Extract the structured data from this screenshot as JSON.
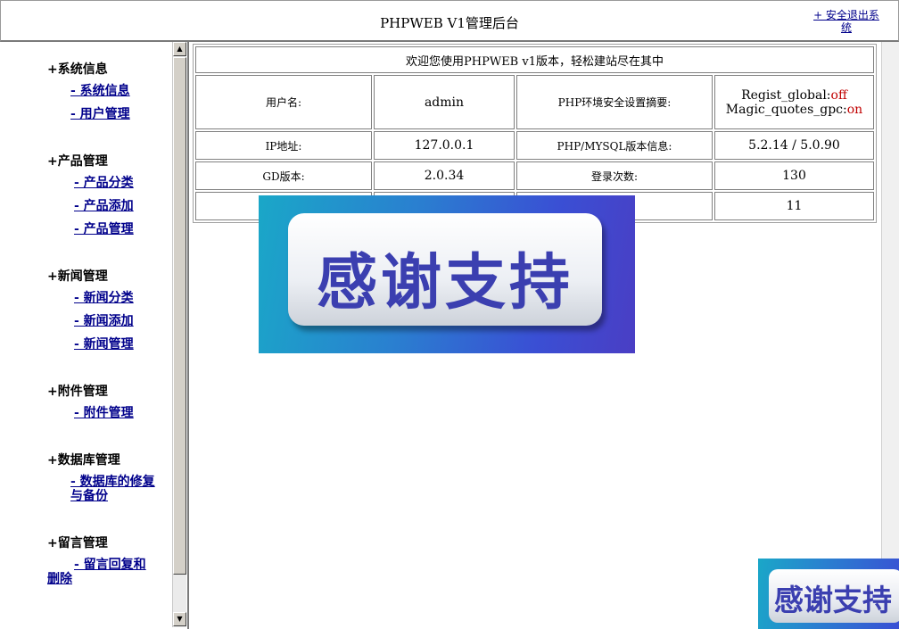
{
  "header": {
    "title": "PHPWEB V1管理后台",
    "logout": "+ 安全退出系统"
  },
  "sidebar": {
    "groups": [
      {
        "title": "+系统信息",
        "items": [
          "- 系统信息",
          "- 用户管理"
        ]
      },
      {
        "title": "+产品管理",
        "items": [
          "- 产品分类",
          "- 产品添加",
          "- 产品管理"
        ]
      },
      {
        "title": "+新闻管理",
        "items": [
          "- 新闻分类",
          "- 新闻添加",
          "- 新闻管理"
        ]
      },
      {
        "title": "+附件管理",
        "items": [
          "- 附件管理"
        ]
      },
      {
        "title": "+数据库管理",
        "items": [
          "- 数据库的修复与备份"
        ]
      },
      {
        "title": "+留言管理",
        "items": [
          "- 留言回复和删除"
        ]
      }
    ],
    "scroll_up": "▲",
    "scroll_down": "▼"
  },
  "main": {
    "welcome": "欢迎您使用PHPWEB v1版本，轻松建站尽在其中",
    "rows": [
      {
        "label1": "用户名:",
        "value1": "admin",
        "label2": "PHP环境安全设置摘要:",
        "value2_a_label": "Regist_global:",
        "value2_a_val": "off",
        "value2_b_label": "Magic_quotes_gpc:",
        "value2_b_val": "on"
      },
      {
        "label1": "IP地址:",
        "value1": "127.0.0.1",
        "label2": "PHP/MYSQL版本信息:",
        "value2": "5.2.14 / 5.0.90"
      },
      {
        "label1": "GD版本:",
        "value1": "2.0.34",
        "label2": "登录次数:",
        "value2": "130"
      },
      {
        "value2": "11"
      }
    ]
  },
  "overlays": {
    "banner_text": "感谢支持",
    "badge_text": "感谢支持"
  }
}
